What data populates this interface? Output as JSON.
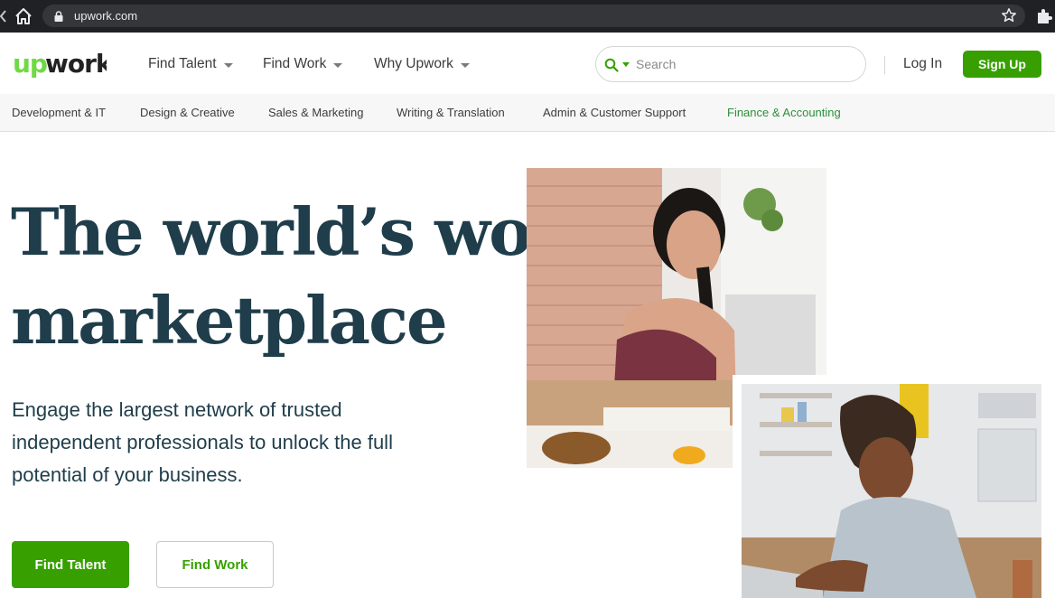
{
  "browser": {
    "url": "upwork.com"
  },
  "header": {
    "logo_text": "upwork",
    "nav": [
      {
        "label": "Find Talent"
      },
      {
        "label": "Find Work"
      },
      {
        "label": "Why Upwork"
      }
    ],
    "search": {
      "placeholder": "Search",
      "value": ""
    },
    "login_label": "Log In",
    "signup_label": "Sign Up"
  },
  "categories": [
    {
      "label": "Development & IT"
    },
    {
      "label": "Design & Creative"
    },
    {
      "label": "Sales & Marketing"
    },
    {
      "label": "Writing & Translation"
    },
    {
      "label": "Admin & Customer Support"
    },
    {
      "label": "Finance & Accounting",
      "active": true
    }
  ],
  "hero": {
    "title_line1": "The world’s work",
    "title_line2": "marketplace",
    "subtitle": "Engage the largest network of trusted independent professionals to unlock the full potential of your business.",
    "primary_button": "Find Talent",
    "secondary_button": "Find Work"
  },
  "colors": {
    "brand_green": "#37a000",
    "heading_navy": "#1f3d4a",
    "active_category": "#2b8f3b"
  }
}
